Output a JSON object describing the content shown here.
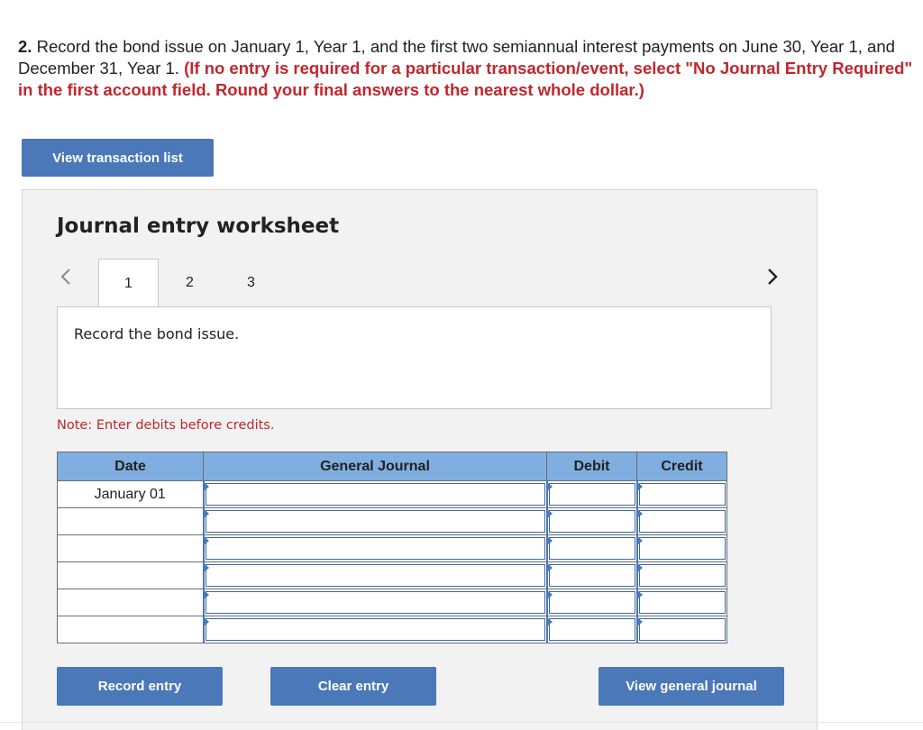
{
  "question": {
    "number": "2.",
    "text": " Record the bond issue on January 1, Year 1, and the first two semiannual interest payments on June 30, Year 1, and December 31, Year 1. ",
    "instruction": "(If no entry is required for a particular transaction/event, select \"No Journal Entry Required\" in the first account field. Round your final answers to the nearest whole dollar.)"
  },
  "view_transaction_list_label": "View transaction list",
  "worksheet": {
    "title": "Journal entry worksheet",
    "tabs": [
      "1",
      "2",
      "3"
    ],
    "active_tab": "1",
    "description": "Record the bond issue.",
    "note": "Note: Enter debits before credits."
  },
  "journal": {
    "headers": {
      "date": "Date",
      "account": "General Journal",
      "debit": "Debit",
      "credit": "Credit"
    },
    "rows": [
      {
        "date": "January 01",
        "account": "",
        "debit": "",
        "credit": ""
      },
      {
        "date": "",
        "account": "",
        "debit": "",
        "credit": ""
      },
      {
        "date": "",
        "account": "",
        "debit": "",
        "credit": ""
      },
      {
        "date": "",
        "account": "",
        "debit": "",
        "credit": ""
      },
      {
        "date": "",
        "account": "",
        "debit": "",
        "credit": ""
      },
      {
        "date": "",
        "account": "",
        "debit": "",
        "credit": ""
      }
    ]
  },
  "buttons": {
    "record": "Record entry",
    "clear": "Clear entry",
    "view_journal": "View general journal"
  },
  "icons": {
    "prev": "chevron-left-icon",
    "next": "chevron-right-icon"
  },
  "colors": {
    "accent": "#4a78b9",
    "header_fill": "#80aee0",
    "instruction": "#c0272d"
  }
}
